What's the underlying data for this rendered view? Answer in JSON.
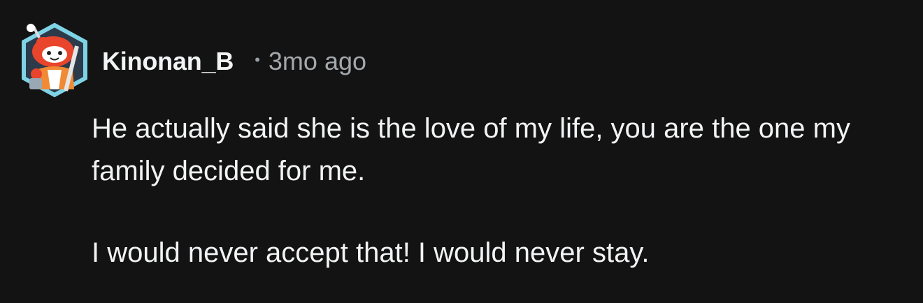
{
  "comment": {
    "author": "Kinonan_B",
    "separator": "•",
    "time_ago": "3mo ago",
    "avatar_icon": "robot-avatar-icon",
    "paragraphs": [
      "He actually said she is the love of my life, you are the one my family decided for me.",
      "I would never accept that! I would never stay."
    ]
  },
  "colors": {
    "background": "#131313",
    "text": "#f2f3f4",
    "meta": "#a4a8ac",
    "avatar_accent": "#e8452c",
    "avatar_frame": "#7fd3e6"
  }
}
